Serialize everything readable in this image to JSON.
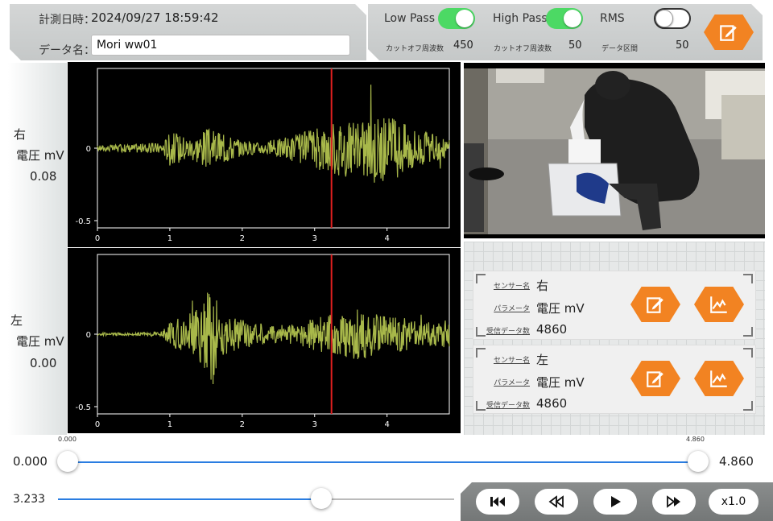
{
  "header": {
    "measure_label": "計測日時：",
    "measure_datetime": "2024/09/27 18:59:42",
    "data_name_label": "データ名：",
    "data_name_value": "Mori ww01",
    "low_pass": {
      "label": "Low Pass",
      "on": true,
      "sub_label": "カットオフ周波数",
      "value": "450"
    },
    "high_pass": {
      "label": "High Pass",
      "on": true,
      "sub_label": "カットオフ周波数",
      "value": "50"
    },
    "rms": {
      "label": "RMS",
      "on": false,
      "sub_label": "データ区間",
      "value": "50"
    },
    "edit_icon": "edit-icon"
  },
  "channels": [
    {
      "side": "右",
      "unit": "電圧 mV",
      "value": "0.08"
    },
    {
      "side": "左",
      "unit": "電圧 mV",
      "value": "0.00"
    }
  ],
  "chart_data": [
    {
      "type": "line",
      "title": "",
      "xlabel": "",
      "ylabel": "",
      "xlim": [
        0,
        4.86
      ],
      "ylim": [
        -0.55,
        0.55
      ],
      "x_ticks": [
        "0",
        "1",
        "2",
        "3",
        "4"
      ],
      "y_ticks": [
        "0",
        "-0.5"
      ],
      "cursor_x": 3.233,
      "line_color": "#a8b84a",
      "cursor_color": "#e02020",
      "envelope": [
        [
          0.0,
          0.02
        ],
        [
          0.5,
          0.03
        ],
        [
          0.9,
          0.04
        ],
        [
          1.0,
          0.12
        ],
        [
          1.3,
          0.08
        ],
        [
          1.5,
          0.14
        ],
        [
          1.8,
          0.1
        ],
        [
          2.0,
          0.05
        ],
        [
          2.3,
          0.04
        ],
        [
          2.6,
          0.08
        ],
        [
          2.9,
          0.12
        ],
        [
          3.1,
          0.16
        ],
        [
          3.4,
          0.2
        ],
        [
          3.6,
          0.18
        ],
        [
          3.8,
          0.26
        ],
        [
          4.0,
          0.22
        ],
        [
          4.2,
          0.2
        ],
        [
          4.5,
          0.12
        ],
        [
          4.86,
          0.06
        ]
      ]
    },
    {
      "type": "line",
      "title": "",
      "xlabel": "",
      "ylabel": "",
      "xlim": [
        0,
        4.86
      ],
      "ylim": [
        -0.55,
        0.55
      ],
      "x_ticks": [
        "0",
        "1",
        "2",
        "3",
        "4"
      ],
      "y_ticks": [
        "0",
        "-0.5"
      ],
      "cursor_x": 3.233,
      "line_color": "#a8b84a",
      "cursor_color": "#e02020",
      "envelope": [
        [
          0.0,
          0.01
        ],
        [
          0.5,
          0.01
        ],
        [
          0.9,
          0.02
        ],
        [
          1.0,
          0.1
        ],
        [
          1.3,
          0.12
        ],
        [
          1.6,
          0.35
        ],
        [
          1.7,
          0.15
        ],
        [
          2.0,
          0.1
        ],
        [
          2.4,
          0.06
        ],
        [
          2.8,
          0.08
        ],
        [
          3.0,
          0.12
        ],
        [
          3.3,
          0.14
        ],
        [
          3.6,
          0.18
        ],
        [
          3.9,
          0.14
        ],
        [
          4.2,
          0.12
        ],
        [
          4.5,
          0.08
        ],
        [
          4.86,
          0.1
        ]
      ]
    }
  ],
  "sensors": [
    {
      "sensor_label": "センサー名",
      "sensor_name": "右",
      "param_label": "パラメータ",
      "param_value": "電圧 mV",
      "count_label": "受信データ数",
      "count_value": "4860"
    },
    {
      "sensor_label": "センサー名",
      "sensor_name": "左",
      "param_label": "パラメータ",
      "param_value": "電圧 mV",
      "count_label": "受信データ数",
      "count_value": "4860"
    }
  ],
  "range_slider": {
    "min_tick": "0.000",
    "max_tick": "4.860",
    "start_value": "0.000",
    "end_value": "4.860",
    "start_fraction": 0.0,
    "end_fraction": 1.0,
    "color": "#2a7de1"
  },
  "position_slider": {
    "value": "3.233",
    "fraction": 0.665,
    "color": "#2a7de1"
  },
  "controls": {
    "speed": "x1.0"
  },
  "colors": {
    "accent": "#f28322",
    "toggle_on": "#4cd964",
    "panel": "#c9cccc"
  }
}
